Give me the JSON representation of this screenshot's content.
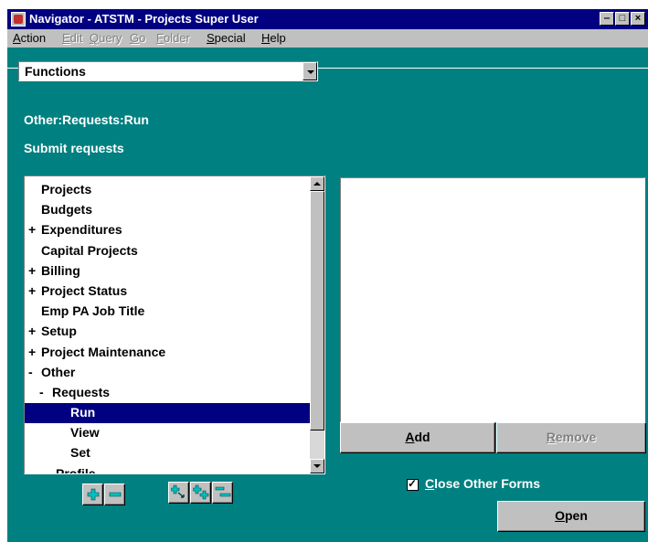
{
  "window": {
    "title": "Navigator - ATSTM - Projects Super User",
    "min_glyph": "‒",
    "max_glyph": "□",
    "close_glyph": "×"
  },
  "menu": {
    "action": {
      "u": "A",
      "rest": "ction"
    },
    "edit": {
      "u": "E",
      "rest": "dit"
    },
    "query": {
      "u": "Q",
      "rest": "uery"
    },
    "go": {
      "u": "G",
      "rest": "o"
    },
    "folder": {
      "u": "F",
      "rest": "older"
    },
    "special": {
      "u": "S",
      "rest": "pecial"
    },
    "help": {
      "u": "H",
      "rest": "elp"
    }
  },
  "functions_combo": {
    "value": "Functions"
  },
  "path_label": "Other:Requests:Run",
  "description": "Submit requests",
  "tree": {
    "items": [
      {
        "label": "Projects",
        "exp": ""
      },
      {
        "label": "Budgets",
        "exp": ""
      },
      {
        "label": "Expenditures",
        "exp": "+"
      },
      {
        "label": "Capital Projects",
        "exp": ""
      },
      {
        "label": "Billing",
        "exp": "+"
      },
      {
        "label": "Project Status",
        "exp": "+"
      },
      {
        "label": "Emp PA Job Title",
        "exp": ""
      },
      {
        "label": "Setup",
        "exp": "+"
      },
      {
        "label": "Project Maintenance",
        "exp": "+"
      },
      {
        "label": "Other",
        "exp": "-"
      },
      {
        "label": "Requests",
        "exp": "-"
      },
      {
        "label": "Run",
        "exp": ""
      },
      {
        "label": "View",
        "exp": ""
      },
      {
        "label": "Set",
        "exp": ""
      },
      {
        "label": "Profile",
        "exp": ""
      }
    ]
  },
  "buttons": {
    "add": {
      "u": "A",
      "rest": "dd"
    },
    "remove": {
      "u": "R",
      "rest": "emove"
    },
    "open": {
      "u": "O",
      "rest": "pen"
    }
  },
  "close_other_forms": {
    "u": "C",
    "rest": "lose Other Forms",
    "checked": true
  },
  "colors": {
    "workspace": "#008080",
    "title_bar": "#000080",
    "selection": "#000080",
    "icon_cyan": "#00c0c0"
  }
}
